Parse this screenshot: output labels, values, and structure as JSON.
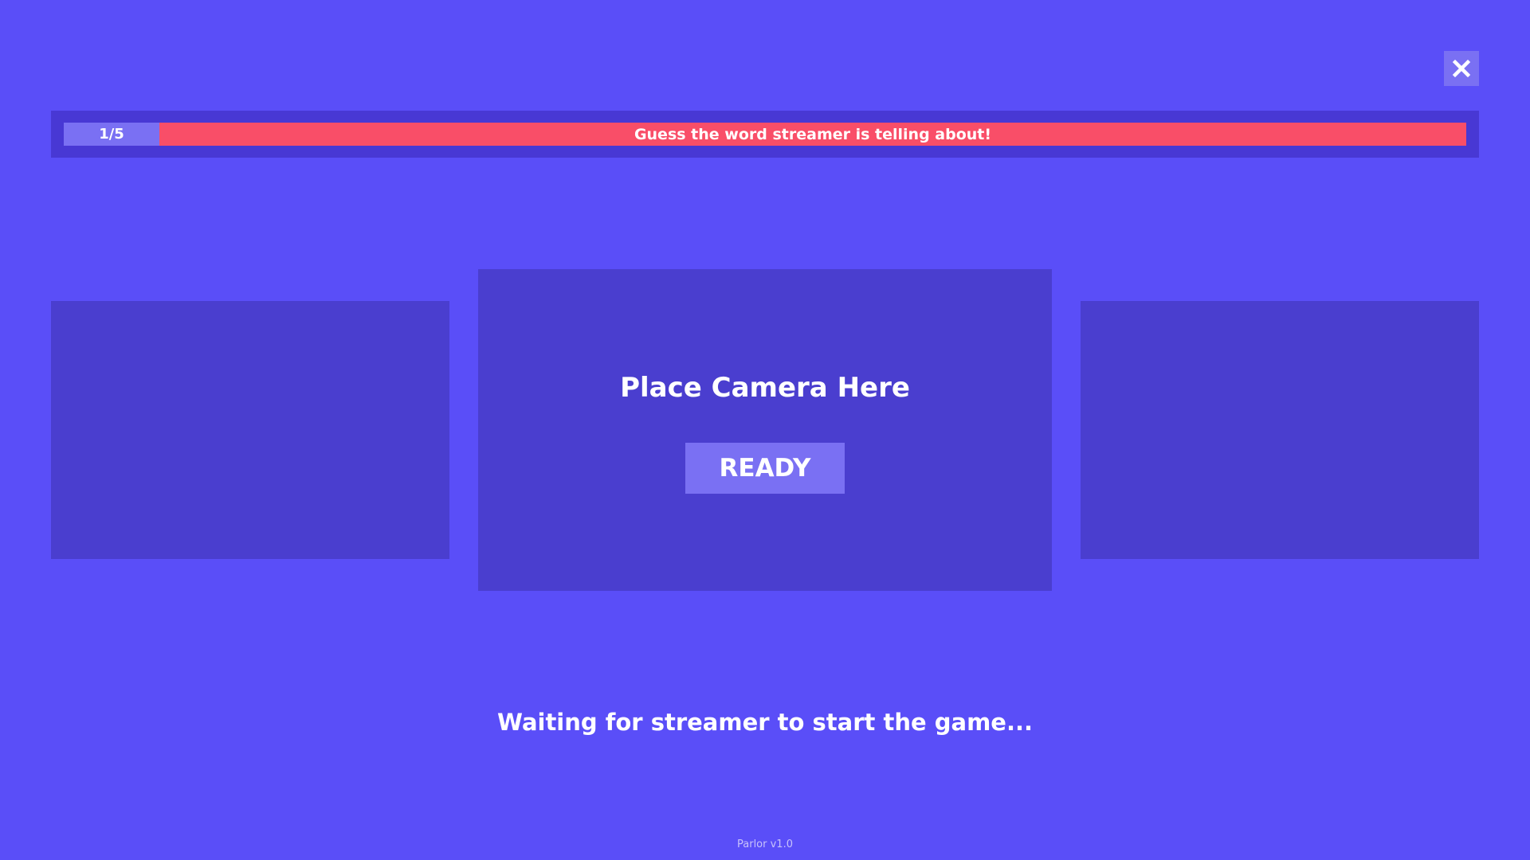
{
  "header": {
    "close_icon": "close-icon"
  },
  "progress": {
    "current": 1,
    "total": 5,
    "label": "1/5"
  },
  "prompt": {
    "text": "Guess the word streamer is telling about!"
  },
  "camera_panel": {
    "label": "Place Camera Here",
    "ready_label": "READY"
  },
  "status": {
    "text": "Waiting for streamer to start the game..."
  },
  "footer": {
    "version": "Parlor v1.0"
  },
  "colors": {
    "background": "#5a4ef8",
    "panel": "#4a3ecf",
    "topbar": "#4838d4",
    "accent_light": "#7a70f3",
    "banner": "#f94e68",
    "text": "#ffffff"
  }
}
